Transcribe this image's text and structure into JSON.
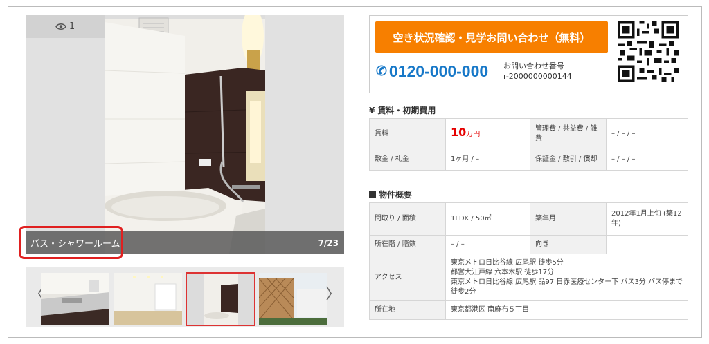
{
  "gallery": {
    "view_count": "1",
    "caption": "バス・シャワールーム",
    "counter": "7/23",
    "prev_arrow": "〈",
    "next_arrow": "〉"
  },
  "contact": {
    "cta_label": "空き状況確認・見学お問い合わせ（無料）",
    "phone_number": "0120-000-000",
    "inquiry_label": "お問い合わせ番号",
    "inquiry_number": "r-2000000000144"
  },
  "fees": {
    "title": "賃料・初期費用",
    "icon": "yen-icon",
    "rows": [
      {
        "l1": "賃料",
        "v1_num": "10",
        "v1_unit": "万円",
        "l2": "管理費 / 共益費 / 雑費",
        "v2": "– / – / –"
      },
      {
        "l1": "敷金 / 礼金",
        "v1": "1ヶ月 / –",
        "l2": "保証金 / 敷引 / 償却",
        "v2": "– / – / –"
      }
    ]
  },
  "overview": {
    "title": "物件概要",
    "icon": "document-icon",
    "layout_label": "間取り / 面積",
    "layout_value": "1LDK / 50㎡",
    "built_label": "築年月",
    "built_value": "2012年1月上旬 (築12年)",
    "floor_label": "所在階 / 階数",
    "floor_value": "– / –",
    "direction_label": "向き",
    "direction_value": "",
    "access_label": "アクセス",
    "access_lines": [
      "東京メトロ日比谷線 広尾駅 徒歩5分",
      "都営大江戸線 六本木駅 徒歩17分",
      "東京メトロ日比谷線 広尾駅 品97 日赤医療センター下 バス3分 バス停まで徒歩2分"
    ],
    "address_label": "所在地",
    "address_value": "東京都港区 南麻布５丁目"
  },
  "colors": {
    "cta": "#f77f00",
    "phone": "#1778c8",
    "price": "#e50000",
    "highlight": "#e02020"
  }
}
